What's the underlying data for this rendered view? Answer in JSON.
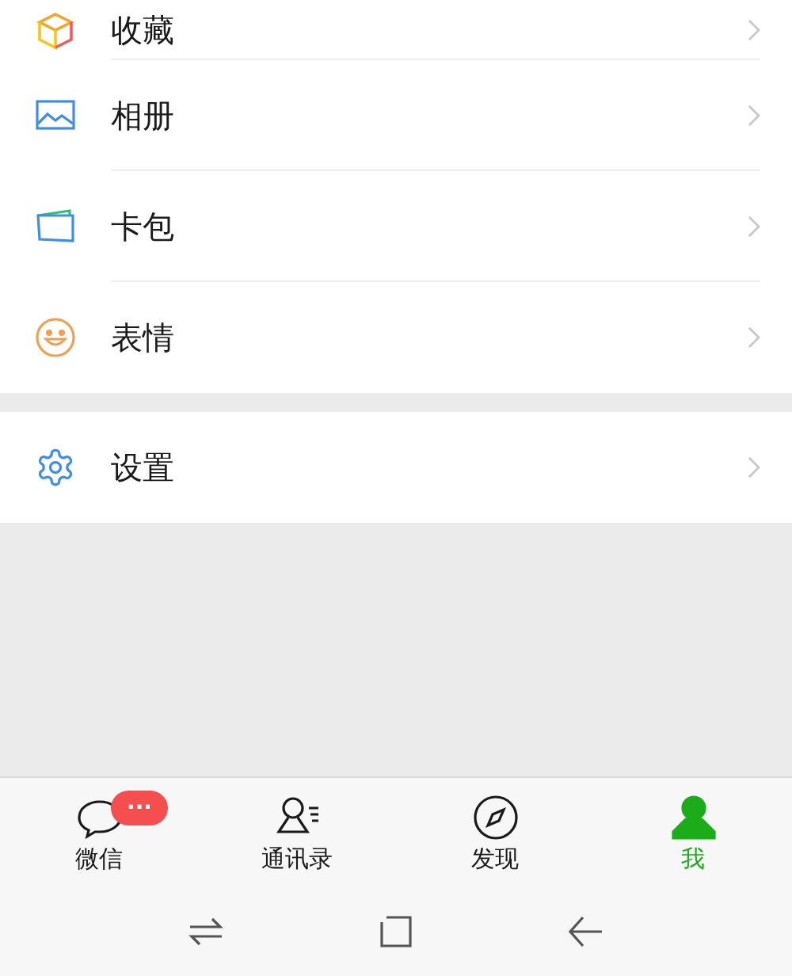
{
  "menu_groups": [
    {
      "items": [
        {
          "kind": "favorites",
          "label": "收藏"
        },
        {
          "kind": "album",
          "label": "相册"
        },
        {
          "kind": "cards",
          "label": "卡包"
        },
        {
          "kind": "stickers",
          "label": "表情"
        }
      ]
    },
    {
      "items": [
        {
          "kind": "settings",
          "label": "设置"
        }
      ]
    }
  ],
  "tab_bar": [
    {
      "kind": "chats",
      "label": "微信",
      "badge": "···",
      "selected": false
    },
    {
      "kind": "contacts",
      "label": "通讯录",
      "selected": false
    },
    {
      "kind": "discover",
      "label": "发现",
      "selected": false
    },
    {
      "kind": "me",
      "label": "我",
      "selected": true
    }
  ]
}
